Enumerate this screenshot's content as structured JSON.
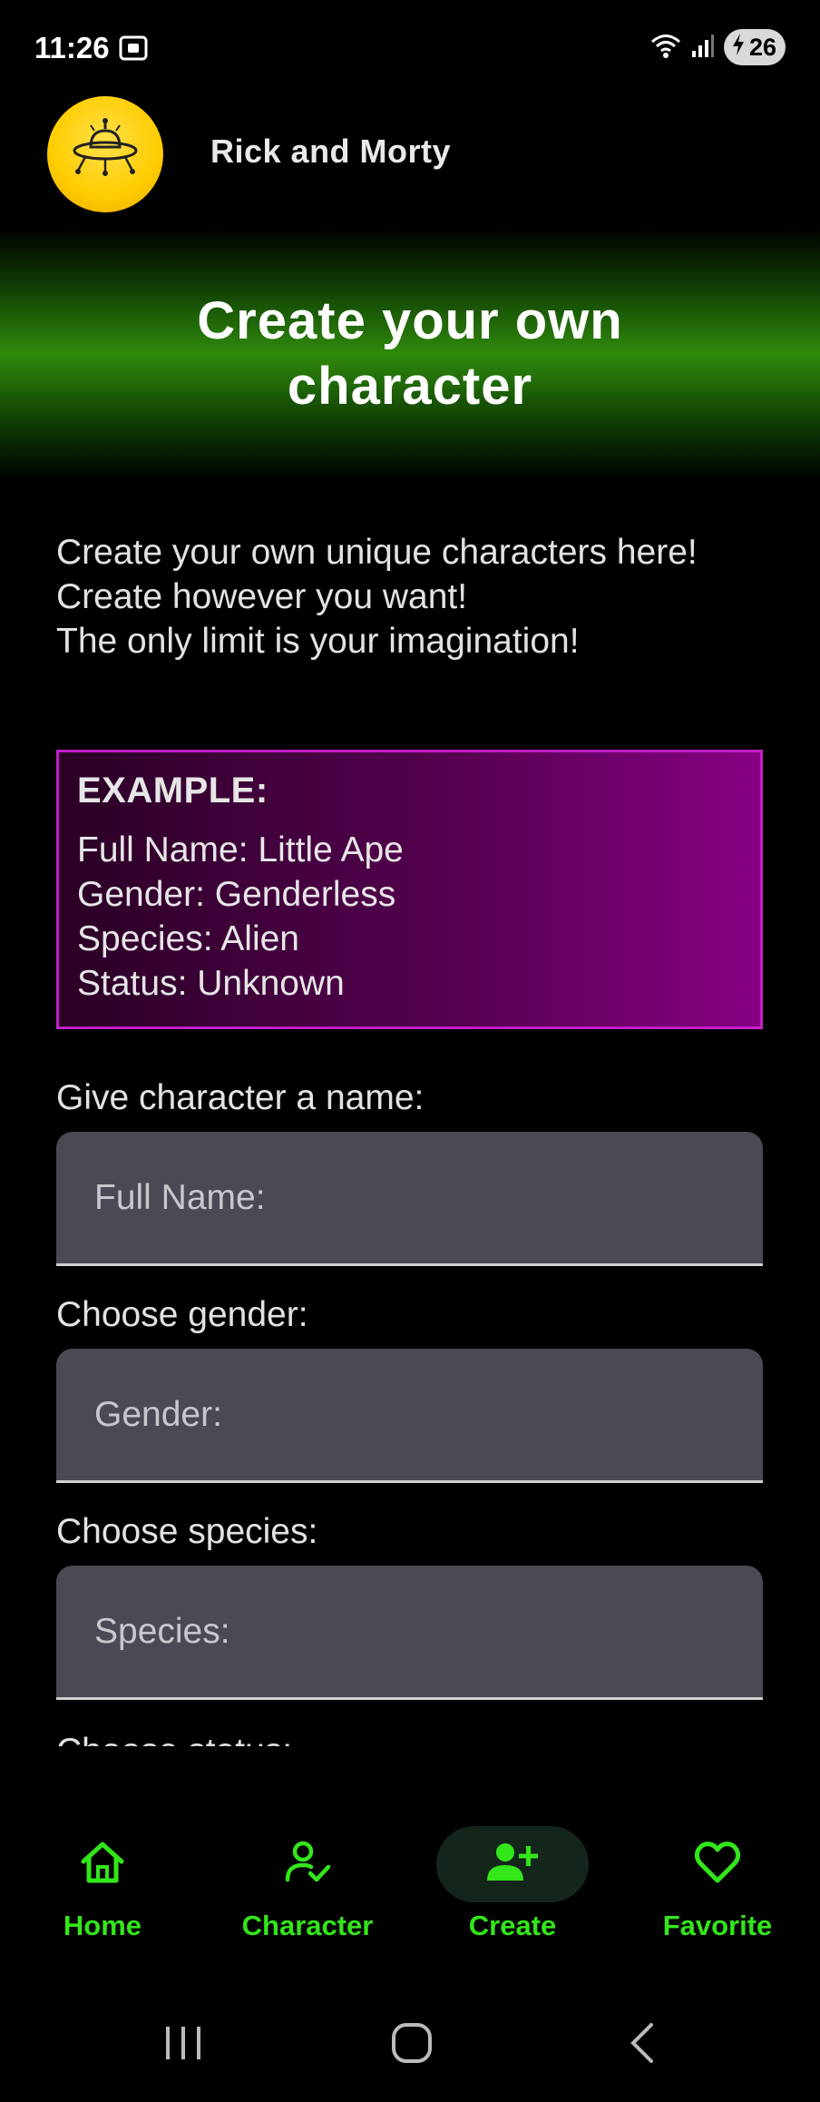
{
  "status_bar": {
    "time": "11:26",
    "battery_level": "26",
    "icons": [
      "screenshot-icon",
      "wifi-icon",
      "signal-icon",
      "battery-charging-icon"
    ]
  },
  "app": {
    "title": "Rick and Morty",
    "logo_icon": "ufo-icon"
  },
  "banner": {
    "title": "Create your own character"
  },
  "intro": {
    "lines": [
      "Create your own unique characters here!",
      "Create however you want!",
      "The only limit is your imagination!"
    ]
  },
  "example": {
    "title": "EXAMPLE:",
    "lines": [
      "Full Name: Little Ape",
      "Gender: Genderless",
      "Species: Alien",
      "Status: Unknown"
    ]
  },
  "form": {
    "name_label": "Give character a name:",
    "name_placeholder": "Full Name:",
    "gender_label": "Choose gender:",
    "gender_placeholder": "Gender:",
    "species_label": "Choose species:",
    "species_placeholder": "Species:",
    "status_label_partial": "Choose status:"
  },
  "bottom_nav": {
    "active": "Create",
    "items": [
      {
        "label": "Home",
        "icon": "home-icon"
      },
      {
        "label": "Character",
        "icon": "person-check-icon"
      },
      {
        "label": "Create",
        "icon": "person-add-icon"
      },
      {
        "label": "Favorite",
        "icon": "heart-icon"
      }
    ]
  },
  "colors": {
    "accent_green": "#33e61a",
    "banner_green": "#2f8a0c",
    "example_border": "#c21fc8",
    "example_bg_end": "#860083",
    "input_bg": "#4a4a55",
    "logo_yellow": "#ffcc00"
  }
}
